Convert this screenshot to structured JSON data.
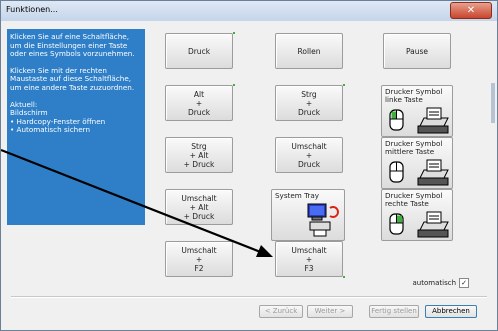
{
  "window": {
    "title": "Funktionen..."
  },
  "panel": {
    "para1": "Klicken Sie auf eine Schaltfläche, um die Einstellungen einer Taste oder eines Symbols vorzunehmen.",
    "para2": "Klicken Sie mit der rechten Maustaste auf diese Schaltfläche, um eine andere Taste zuzuordnen.",
    "current_heading": "Aktuell:",
    "current_lines": [
      "Bildschirm",
      "• Hardcopy-Fenster öffnen",
      "• Automatisch sichern"
    ]
  },
  "buttons": {
    "druck": [
      "Druck"
    ],
    "rollen": [
      "Rollen"
    ],
    "pause": [
      "Pause"
    ],
    "alt_druck": [
      "Alt",
      "+",
      "Druck"
    ],
    "strg_druck": [
      "Strg",
      "+",
      "Druck"
    ],
    "strg_alt_druck": [
      "Strg",
      "+ Alt",
      "+ Druck"
    ],
    "umschalt_druck": [
      "Umschalt",
      "+",
      "Druck"
    ],
    "umschalt_alt_druck": [
      "Umschalt",
      "+ Alt",
      "+ Druck"
    ],
    "umschalt_f2": [
      "Umschalt",
      "+",
      "F2"
    ],
    "umschalt_f3": [
      "Umschalt",
      "+",
      "F3"
    ],
    "system_tray": "System Tray",
    "printer_left": [
      "Drucker Symbol",
      "linke Taste"
    ],
    "printer_middle": [
      "Drucker Symbol",
      "mittlere Taste"
    ],
    "printer_right": [
      "Drucker Symbol",
      "rechte Taste"
    ]
  },
  "auto_checkbox": {
    "label": "automatisch",
    "checked": true
  },
  "footer": {
    "back": "< Zurück",
    "next": "Weiter >",
    "finish": "Fertig stellen",
    "cancel": "Abbrechen"
  },
  "colors": {
    "panel_bg": "#2e7fc8",
    "indicator": "#3fb03f"
  }
}
